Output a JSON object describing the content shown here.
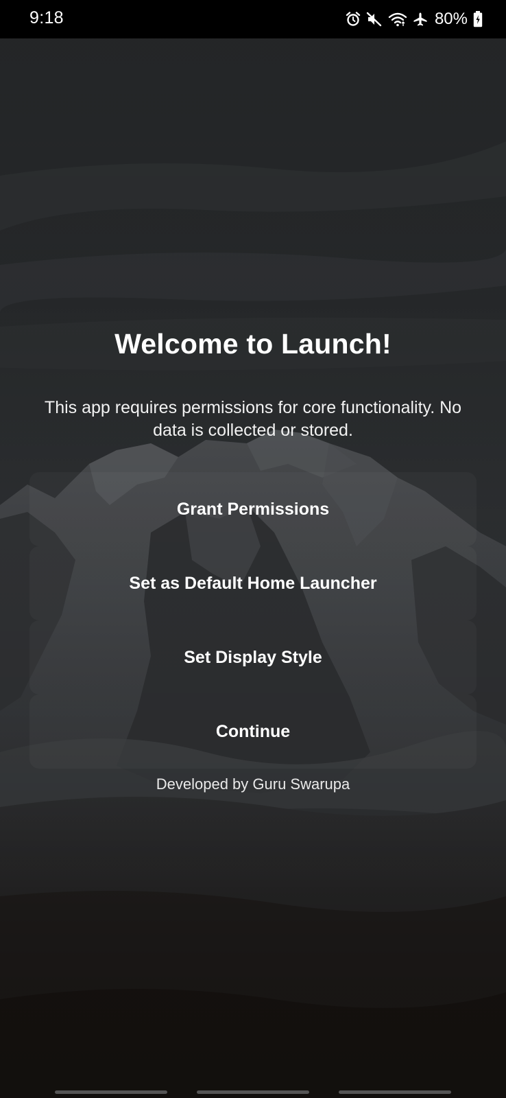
{
  "status_bar": {
    "time": "9:18",
    "battery_percent": "80%",
    "icons": [
      "alarm-icon",
      "mute-icon",
      "wifi-icon",
      "airplane-icon",
      "battery-icon"
    ]
  },
  "welcome": {
    "title": "Welcome to Launch!",
    "description": "This app requires permissions for core functionality. No data is collected or stored."
  },
  "actions": {
    "grant_permissions": "Grant Permissions",
    "set_default_launcher": "Set as Default Home Launcher",
    "set_display_style": "Set Display Style",
    "continue": "Continue"
  },
  "footer": {
    "credit": "Developed by Guru Swarupa"
  },
  "colors": {
    "text": "#ffffff",
    "status_bar_bg": "#000000"
  }
}
